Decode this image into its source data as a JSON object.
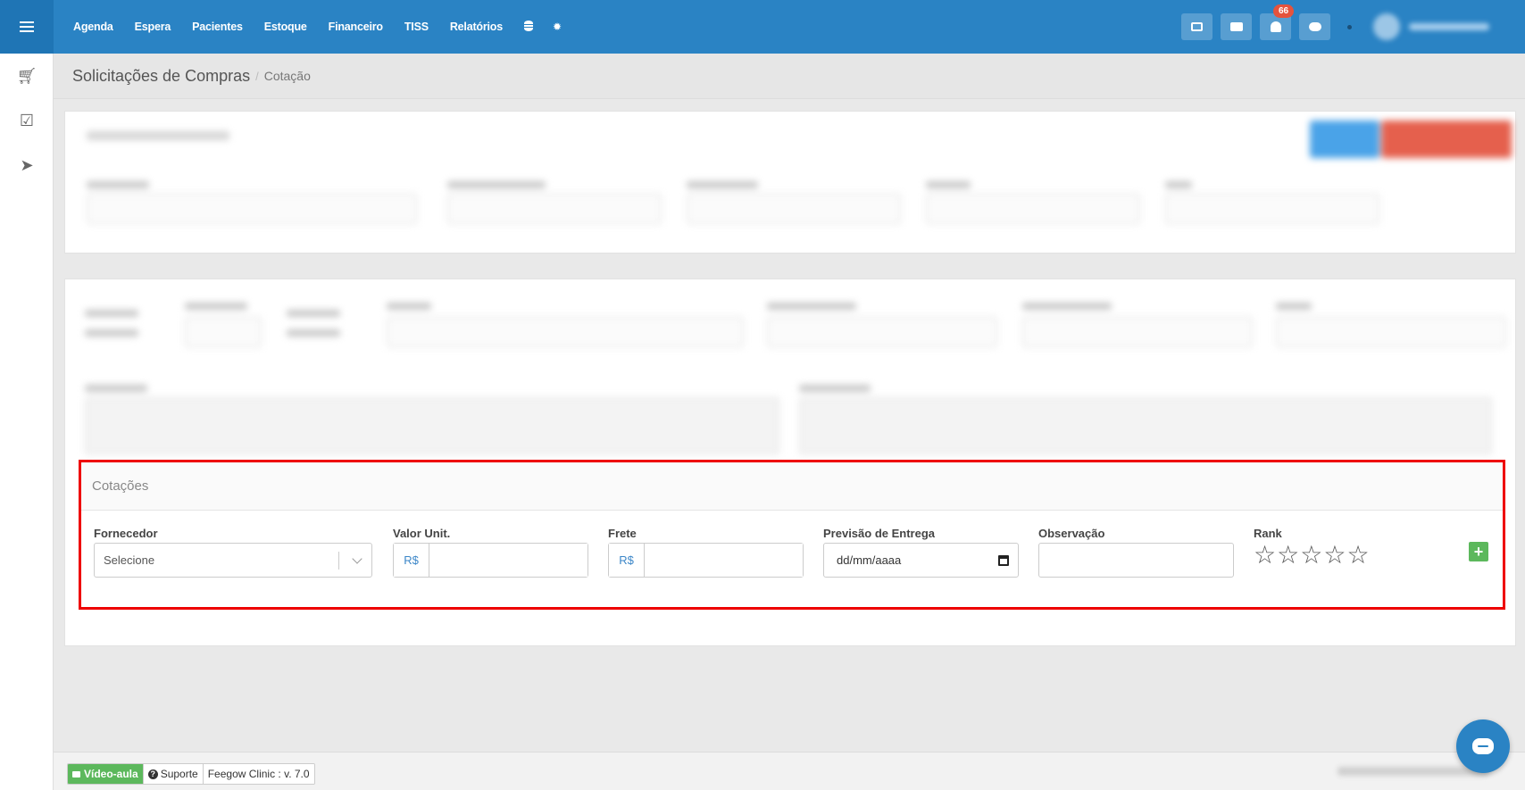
{
  "topnav": {
    "items": [
      "Agenda",
      "Espera",
      "Pacientes",
      "Estoque",
      "Financeiro",
      "TISS",
      "Relatórios"
    ],
    "notification_count": "66"
  },
  "breadcrumb": {
    "main": "Solicitações de Compras",
    "separator": "/",
    "sub": "Cotação"
  },
  "cotacoes": {
    "title": "Cotações",
    "fornecedor": {
      "label": "Fornecedor",
      "value": "Selecione"
    },
    "valor_unit": {
      "label": "Valor Unit.",
      "prefix": "R$"
    },
    "frete": {
      "label": "Frete",
      "prefix": "R$"
    },
    "previsao": {
      "label": "Previsão de Entrega",
      "placeholder": "dd/mm/aaaa"
    },
    "observacao": {
      "label": "Observação"
    },
    "rank": {
      "label": "Rank",
      "value": 0,
      "max": 5
    },
    "add_label": "+"
  },
  "footer": {
    "video": "Vídeo-aula",
    "suporte": "Suporte",
    "version": "Feegow Clinic : v. 7.0"
  },
  "colors": {
    "topbar": "#2a83c4",
    "highlight": "#ee0000",
    "add": "#5cb85c",
    "badge": "#e5533d"
  }
}
